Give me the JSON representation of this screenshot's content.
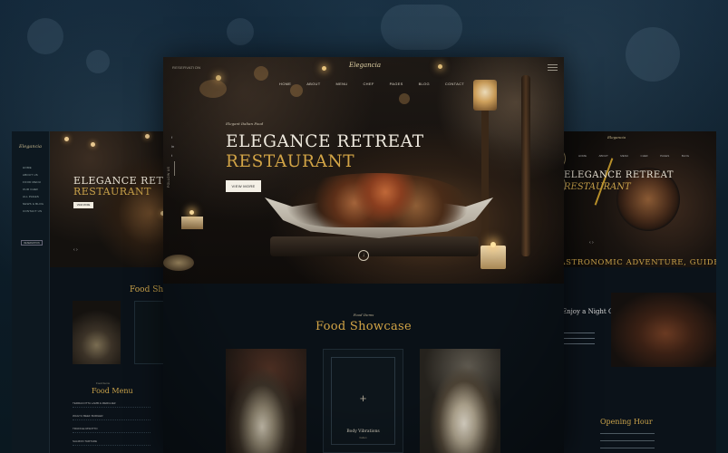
{
  "brand": {
    "logo": "Elegancia"
  },
  "header": {
    "reservation": "RESERVATION",
    "nav": [
      "HOME",
      "ABOUT",
      "MENU",
      "CHEF",
      "PAGES",
      "BLOG",
      "CONTACT"
    ]
  },
  "social": [
    "f",
    "in",
    "t"
  ],
  "hero": {
    "kicker": "Elegant Italian Food",
    "title_line1": "ELEGANCE RETREAT",
    "title_line2": "RESTAURANT",
    "cta": "VIEW MORE",
    "scroll_label": "FOLLOW US"
  },
  "showcase": {
    "kicker": "Food Items",
    "title": "Food Showcase",
    "cards": [
      {
        "name": "",
        "sub": ""
      },
      {
        "name": "Body Vibrations",
        "sub": "Italian"
      },
      {
        "name": "",
        "sub": ""
      }
    ]
  },
  "left_preview": {
    "logo": "Elegancia",
    "nav": [
      "HOME",
      "ABOUT US",
      "FOOD MENU",
      "OUR CHEF",
      "ALL PAGES",
      "NEWS & BLOG",
      "CONTACT US"
    ],
    "reservation": "RESERVATION",
    "title_line1": "ELEGANCE RETREAT",
    "title_line2": "RESTAURANT",
    "cta": "VIEW MORE",
    "arrows": "‹  ›",
    "food_title": "Food Showcase",
    "menu_kicker": "Food Items",
    "menu_title": "Food Menu",
    "menu_rows": [
      "TERRACOTTA LAMB & MERGUEZ",
      "WAGYU BEEF BURGER",
      "TRUFFLE RISOTTO",
      "SALMON TARTARE"
    ]
  },
  "right_preview": {
    "logo": "Elegancia",
    "nav": [
      "HOME",
      "ABOUT",
      "MENU",
      "CHEF",
      "PAGES",
      "BLOG",
      "CONTACT"
    ],
    "title_line1": "ELEGANCE RETREAT",
    "title_line2": "RESTAURANT",
    "arrows": "‹  ›",
    "band": "GASTRONOMIC ADVENTURE, GUIDED BY OUR EXPERTS",
    "side_heading": "Enjoy a Night Out",
    "hours_title": "Opening Hour"
  }
}
